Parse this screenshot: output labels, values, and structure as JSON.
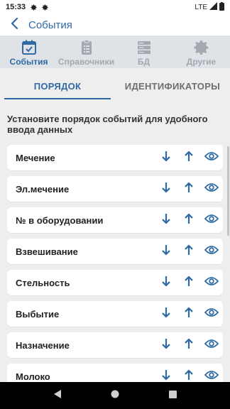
{
  "status_bar": {
    "time": "15:33",
    "network": "LTE"
  },
  "app_bar": {
    "title": "События"
  },
  "top_nav": [
    {
      "label": "События",
      "icon": "calendar-check-icon",
      "active": true
    },
    {
      "label": "Справочники",
      "icon": "clipboard-list-icon",
      "active": false
    },
    {
      "label": "БД",
      "icon": "database-icon",
      "active": false
    },
    {
      "label": "Другие",
      "icon": "gear-icon",
      "active": false
    }
  ],
  "tabs": [
    {
      "label": "ПОРЯДОК",
      "active": true
    },
    {
      "label": "ИДЕНТИФИКАТОРЫ",
      "active": false
    }
  ],
  "hint": "Установите порядок событий для удобного ввода данных",
  "events": [
    {
      "label": "Мечение"
    },
    {
      "label": "Эл.мечение"
    },
    {
      "label": "№ в оборудовании"
    },
    {
      "label": "Взвешивание"
    },
    {
      "label": "Стельность"
    },
    {
      "label": "Выбытие"
    },
    {
      "label": "Назначение"
    },
    {
      "label": "Молоко"
    }
  ],
  "colors": {
    "accent": "#2f6aa5",
    "inactive": "#a4a9b0",
    "nav_bg": "#dfe3e8",
    "page_bg": "#eeeeee"
  }
}
